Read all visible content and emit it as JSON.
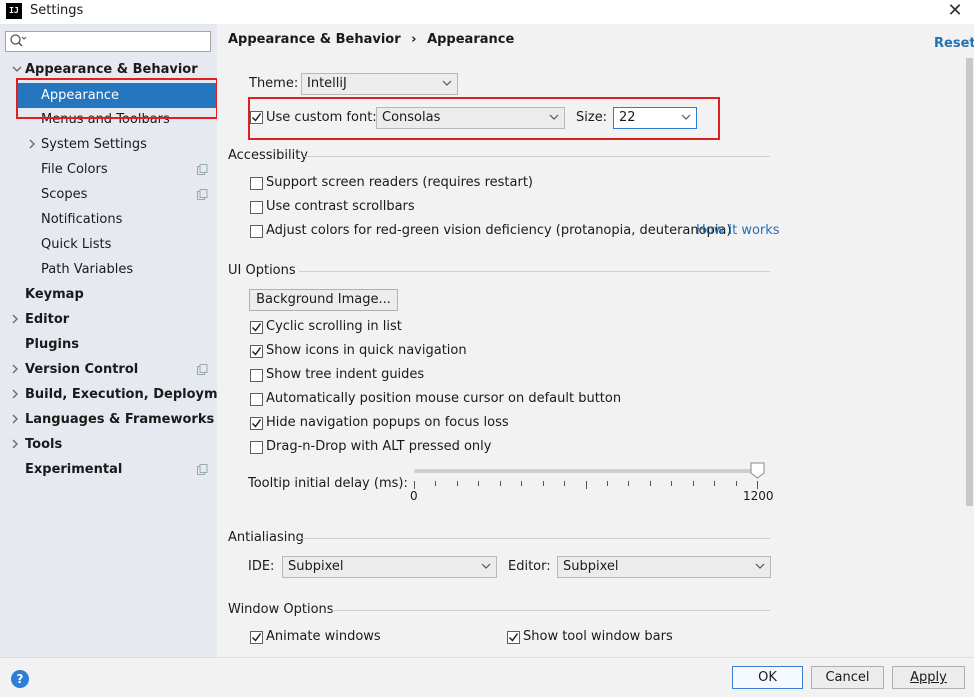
{
  "window": {
    "title": "Settings",
    "app_icon_text": "IJ"
  },
  "sidebar": {
    "search_placeholder": "",
    "items": [
      {
        "label": "Appearance & Behavior",
        "bold": true,
        "arrow": "down"
      },
      {
        "label": "Appearance",
        "selected": true
      },
      {
        "label": "Menus and Toolbars"
      },
      {
        "label": "System Settings",
        "arrow": "right"
      },
      {
        "label": "File Colors",
        "copy_icon": true
      },
      {
        "label": "Scopes",
        "copy_icon": true
      },
      {
        "label": "Notifications"
      },
      {
        "label": "Quick Lists"
      },
      {
        "label": "Path Variables"
      },
      {
        "label": "Keymap",
        "bold": true
      },
      {
        "label": "Editor",
        "bold": true,
        "arrow": "right"
      },
      {
        "label": "Plugins",
        "bold": true
      },
      {
        "label": "Version Control",
        "bold": true,
        "arrow": "right",
        "copy_icon": true
      },
      {
        "label": "Build, Execution, Deployment",
        "bold": true,
        "arrow": "right"
      },
      {
        "label": "Languages & Frameworks",
        "bold": true,
        "arrow": "right"
      },
      {
        "label": "Tools",
        "bold": true,
        "arrow": "right"
      },
      {
        "label": "Experimental",
        "bold": true,
        "copy_icon": true
      }
    ]
  },
  "header": {
    "breadcrumb_parent": "Appearance & Behavior",
    "breadcrumb_sep": "›",
    "breadcrumb_current": "Appearance",
    "reset_label": "Reset"
  },
  "appearance": {
    "theme_label": "Theme:",
    "theme_value": "IntelliJ",
    "custom_font_label": "Use custom font:",
    "custom_font_checked": true,
    "font_value": "Consolas",
    "size_label": "Size:",
    "size_value": "22"
  },
  "accessibility": {
    "title": "Accessibility",
    "options": [
      {
        "label": "Support screen readers (requires restart)",
        "checked": false
      },
      {
        "label": "Use contrast scrollbars",
        "checked": false
      },
      {
        "label": "Adjust colors for red-green vision deficiency (protanopia, deuteranopia)",
        "checked": false
      }
    ],
    "how_it_works": "How it works"
  },
  "ui_options": {
    "title": "UI Options",
    "background_button": "Background Image...",
    "options": [
      {
        "label": "Cyclic scrolling in list",
        "checked": true
      },
      {
        "label": "Show icons in quick navigation",
        "checked": true
      },
      {
        "label": "Show tree indent guides",
        "checked": false
      },
      {
        "label": "Automatically position mouse cursor on default button",
        "checked": false
      },
      {
        "label": "Hide navigation popups on focus loss",
        "checked": true
      },
      {
        "label": "Drag-n-Drop with ALT pressed only",
        "checked": false
      }
    ],
    "tooltip_label": "Tooltip initial delay (ms):",
    "tooltip_min": "0",
    "tooltip_max": "1200",
    "tooltip_value": 1200
  },
  "antialiasing": {
    "title": "Antialiasing",
    "ide_label": "IDE:",
    "ide_value": "Subpixel",
    "editor_label": "Editor:",
    "editor_value": "Subpixel"
  },
  "window_options": {
    "title": "Window Options",
    "options": [
      {
        "label": "Animate windows",
        "checked": true
      },
      {
        "label": "Show tool window bars",
        "checked": true
      }
    ]
  },
  "footer": {
    "help_label": "?",
    "ok_label": "OK",
    "cancel_label": "Cancel",
    "apply_label": "Apply"
  },
  "colors": {
    "selection": "#2675bf",
    "link": "#2470b3",
    "annotation_red": "#e02020",
    "sidebar_bg": "#e6eaf0"
  }
}
